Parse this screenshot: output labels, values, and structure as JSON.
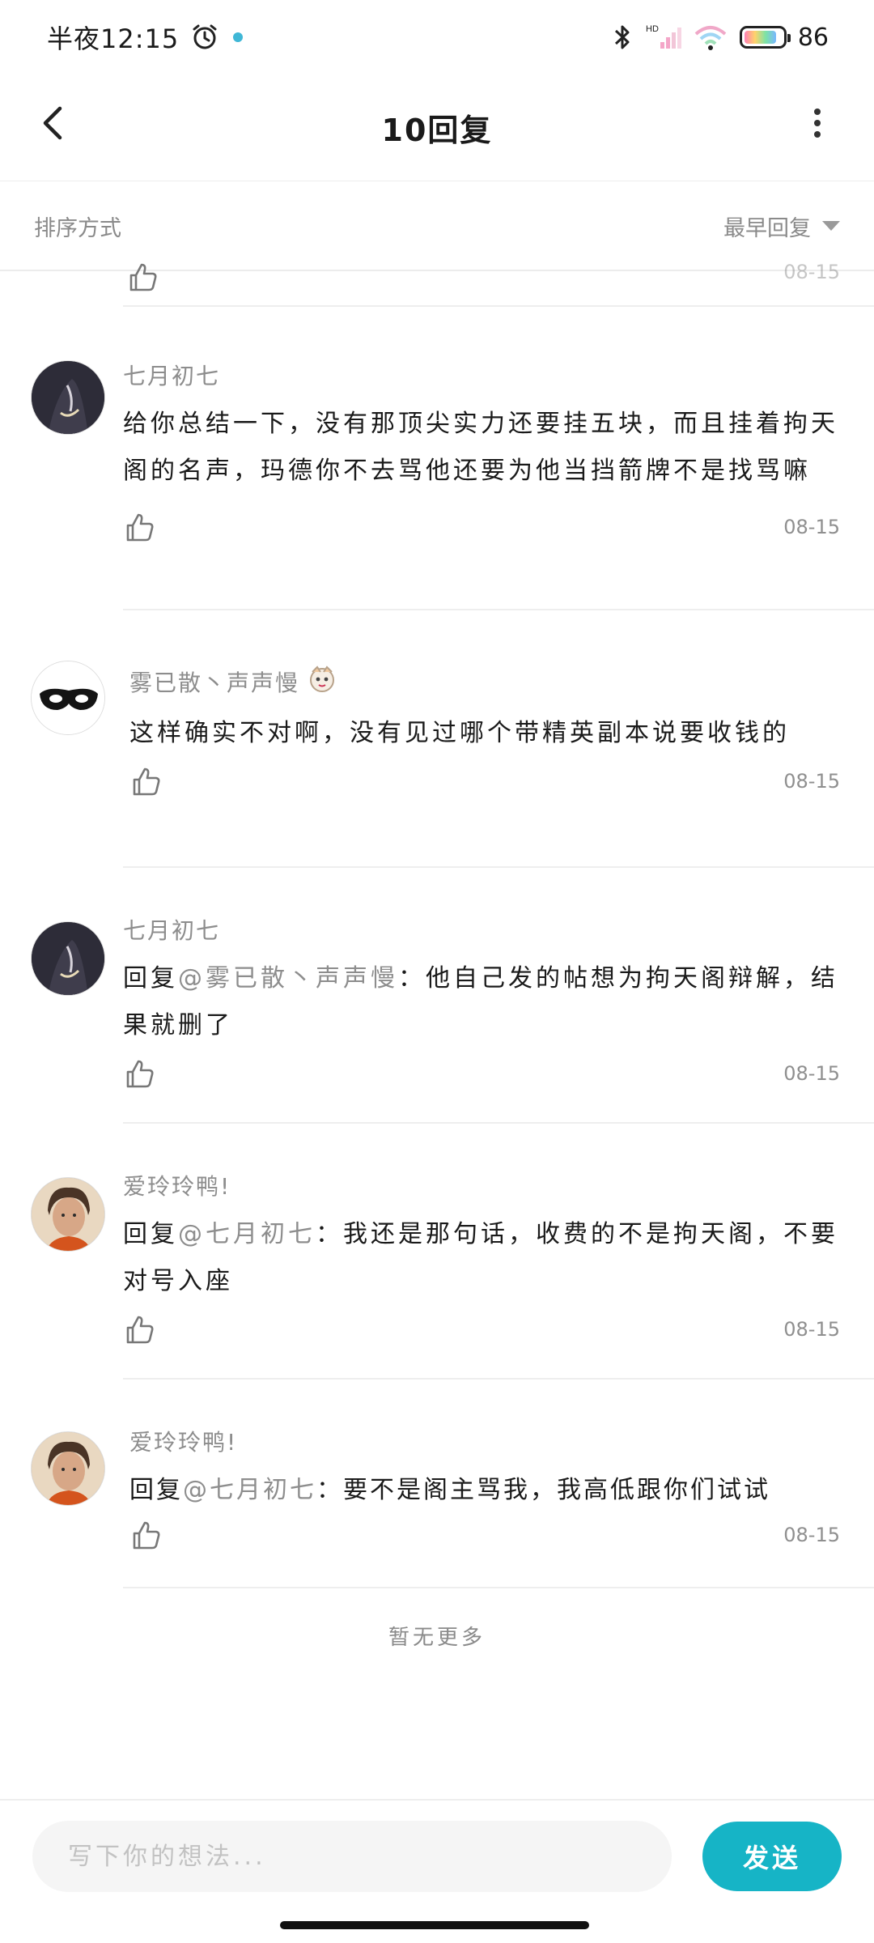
{
  "status_bar": {
    "time": "半夜12:15",
    "network": "HD",
    "battery_level": "86",
    "battery_fraction": 0.86
  },
  "header": {
    "title": "10回复"
  },
  "sort_bar": {
    "label": "排序方式",
    "selected": "最早回复"
  },
  "partial_comment": {
    "date": "08-15"
  },
  "comments": [
    {
      "user": "七月初七",
      "text": "给你总结一下，没有那顶尖实力还要挂五块，而且挂着拘天阁的名声，玛德你不去骂他还要为他当挡箭牌不是找骂嘛",
      "date": "08-15",
      "avatar": "dark-hooded-figure"
    },
    {
      "user": "雾已散丶声声慢",
      "text": "这样确实不对啊，没有见过哪个带精英副本说要收钱的",
      "date": "08-15",
      "avatar": "black-mask"
    },
    {
      "user": "七月初七",
      "reply_prefix": "回复",
      "mention": "@雾已散丶声声慢",
      "text": "：他自己发的帖想为拘天阁辩解，结果就删了",
      "date": "08-15",
      "avatar": "dark-hooded-figure"
    },
    {
      "user": "爱玲玲鸭!",
      "reply_prefix": "回复",
      "mention": "@七月初七",
      "text": "：我还是那句话，收费的不是拘天阁，不要对号入座",
      "date": "08-15",
      "avatar": "young-man-portrait"
    },
    {
      "user": "爱玲玲鸭!",
      "reply_prefix": "回复",
      "mention": "@七月初七",
      "text": "：要不是阁主骂我，我高低跟你们试试",
      "date": "08-15",
      "avatar": "young-man-portrait"
    }
  ],
  "footer_note": "暂无更多",
  "composer": {
    "placeholder": "写下你的想法...",
    "send_label": "发送"
  },
  "colors": {
    "accent": "#16b4c6",
    "muted_text": "#8d8d8d",
    "divider": "#eeeeee"
  }
}
